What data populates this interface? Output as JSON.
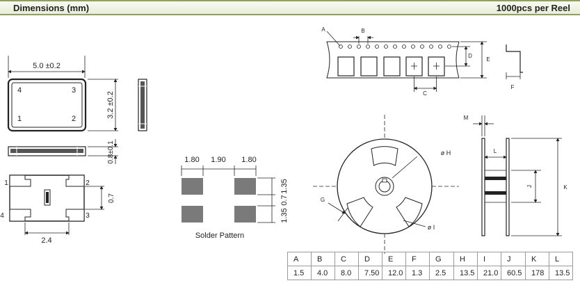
{
  "header": {
    "left_title": "Dimensions (mm)",
    "right_title": "1000pcs per Reel"
  },
  "package": {
    "width_label": "5.0 ±0.2",
    "height_label": "3.2 ±0.2",
    "thickness_label": "0.8±0.1",
    "pin_labels": [
      "1",
      "2",
      "3",
      "4"
    ],
    "bottom_pitch_label": "2.4",
    "bottom_pad_label": "0.7",
    "bottom_pin_labels": [
      "1",
      "2",
      "3",
      "4"
    ]
  },
  "solder": {
    "dims": [
      "1.80",
      "1.90",
      "1.80"
    ],
    "vertical_dims": [
      "1.35",
      "0.7",
      "1.35"
    ],
    "caption": "Solder Pattern"
  },
  "tape": {
    "letters": [
      "A",
      "B",
      "C",
      "D",
      "E",
      "F"
    ]
  },
  "reel": {
    "letters": [
      "ø H",
      "ø I",
      "G",
      "M",
      "L",
      "J",
      "K"
    ]
  },
  "table": {
    "headers": [
      "A",
      "B",
      "C",
      "D",
      "E",
      "F",
      "G",
      "H",
      "I",
      "J",
      "K",
      "L"
    ],
    "values": [
      "1.5",
      "4.0",
      "8.0",
      "7.50",
      "12.0",
      "1.3",
      "2.5",
      "13.5",
      "21.0",
      "60.5",
      "178",
      "13.5"
    ]
  }
}
